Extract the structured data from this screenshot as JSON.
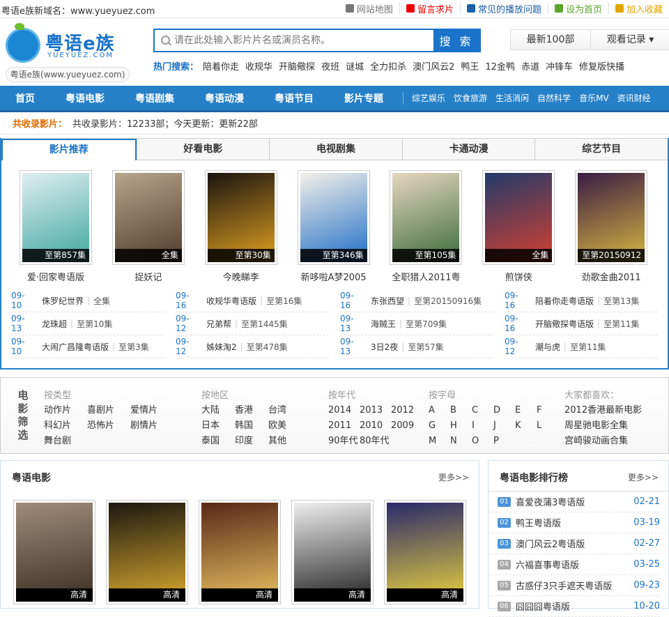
{
  "topbar": {
    "domain_text": "粤语e族新域名：www.yueyuez.com",
    "links": [
      {
        "label": "网站地图",
        "icon": "map-icon",
        "color": "#777"
      },
      {
        "label": "留言求片",
        "icon": "message-icon",
        "color": "#e00"
      },
      {
        "label": "常见的播放问题",
        "icon": "help-icon",
        "color": "#1b5fa8"
      },
      {
        "label": "设为首页",
        "icon": "plus-icon",
        "color": "#5aa52a"
      },
      {
        "label": "加入收藏",
        "icon": "star-icon",
        "color": "#e5a500"
      }
    ]
  },
  "logo": {
    "name": "粤语e族",
    "en": "YUEYUEZ.COM",
    "sub": "粤语e族(www.yueyuez.com)"
  },
  "search": {
    "placeholder": "请在此处输入影片片名或演员名称。",
    "button": "搜 索"
  },
  "hot": {
    "label": "热门搜索：",
    "keywords": [
      "陪着你走",
      "收规华",
      "开脑儆探",
      "夜班",
      "谜城",
      "全力扣杀",
      "澳门风云2",
      "鸭王",
      "12金鸭",
      "赤道",
      "冲锋车",
      "修复版快播"
    ]
  },
  "header_buttons": [
    "最新100部",
    "观看记录 ▾"
  ],
  "nav": {
    "main": [
      "首页",
      "粤语电影",
      "粤语剧集",
      "粤语动漫",
      "粤语节目",
      "影片专题"
    ],
    "sub": [
      "综艺娱乐",
      "饮食旅游",
      "生活消闲",
      "自然科学",
      "音乐MV",
      "资讯财经"
    ]
  },
  "stats": {
    "label": "共收录影片：",
    "text": "共收录影片：12233部；今天更新：更新22部"
  },
  "tabs": [
    "影片推荐",
    "好看电影",
    "电视剧集",
    "卡通动漫",
    "综艺节目"
  ],
  "recommend": [
    {
      "title": "爱·回家粤语版",
      "caption": "至第857集",
      "bg": "#dfeef0",
      "fg": "#3fa7a0"
    },
    {
      "title": "捉妖记",
      "caption": "全集",
      "bg": "#b8a58c",
      "fg": "#4f3b2a"
    },
    {
      "title": "今晚睇李",
      "caption": "至第30集",
      "bg": "#1a1410",
      "fg": "#e0a020"
    },
    {
      "title": "新哆啦A梦2005",
      "caption": "至第346集",
      "bg": "#f3f0e8",
      "fg": "#1f6ec8"
    },
    {
      "title": "全职猎人2011粤",
      "caption": "至第105集",
      "bg": "#e6d7c0",
      "fg": "#3b6b3b"
    },
    {
      "title": "煎饼侠",
      "caption": "全集",
      "bg": "#223a6a",
      "fg": "#d54030"
    },
    {
      "title": "劲歌金曲2011",
      "caption": "至第20150912集",
      "bg": "#3a1c44",
      "fg": "#d7b640"
    }
  ],
  "updates": [
    {
      "date": "09-10",
      "title": "侏罗纪世界",
      "ep": "全集"
    },
    {
      "date": "09-16",
      "title": "收规华粤语版",
      "ep": "至第16集"
    },
    {
      "date": "09-16",
      "title": "东张西望",
      "ep": "至第20150916集"
    },
    {
      "date": "09-16",
      "title": "陪着你走粤语版",
      "ep": "至第13集"
    },
    {
      "date": "09-13",
      "title": "龙珠超",
      "ep": "至第10集"
    },
    {
      "date": "09-12",
      "title": "兄弟帮",
      "ep": "至第1445集"
    },
    {
      "date": "09-13",
      "title": "海贼王",
      "ep": "至第709集"
    },
    {
      "date": "09-16",
      "title": "开脑儆探粤语版",
      "ep": "至第11集"
    },
    {
      "date": "09-10",
      "title": "大闹广昌隆粤语版",
      "ep": "至第3集"
    },
    {
      "date": "09-12",
      "title": "姊妹淘2",
      "ep": "至第478集"
    },
    {
      "date": "09-13",
      "title": "3日2夜",
      "ep": "至第57集"
    },
    {
      "date": "09-12",
      "title": "潮与虎",
      "ep": "至第11集"
    }
  ],
  "filter": {
    "title": "电影筛选",
    "type": {
      "heading": "按类型",
      "items": [
        "动作片",
        "喜剧片",
        "爱情片",
        "科幻片",
        "恐怖片",
        "剧情片",
        "舞台剧"
      ]
    },
    "region": {
      "heading": "按地区",
      "items": [
        "大陆",
        "香港",
        "台湾",
        "日本",
        "韩国",
        "欧美",
        "泰国",
        "印度",
        "其他"
      ]
    },
    "year": {
      "heading": "按年代",
      "items": [
        "2014",
        "2013",
        "2012",
        "2011",
        "2010",
        "2009",
        "90年代",
        "80年代"
      ]
    },
    "letter": {
      "heading": "按字母",
      "items": [
        "A",
        "B",
        "C",
        "D",
        "E",
        "F",
        "G",
        "H",
        "I",
        "J",
        "K",
        "L",
        "M",
        "N",
        "O",
        "P"
      ]
    },
    "like": {
      "heading": "大家都喜欢：",
      "items": [
        "2012香港最新电影",
        "周星驰电影全集",
        "宫崎骏动画合集"
      ]
    }
  },
  "movies": {
    "title": "粤语电影",
    "more": "更多>>",
    "items": [
      {
        "caption": "高清",
        "bg": "#9d8c78",
        "fg": "#3c2e22"
      },
      {
        "caption": "高清",
        "bg": "#1c1810",
        "fg": "#d8a830"
      },
      {
        "caption": "高清",
        "bg": "#5a2818",
        "fg": "#e8c060"
      },
      {
        "caption": "高清",
        "bg": "#eeeeee",
        "fg": "#222222"
      },
      {
        "caption": "高清",
        "bg": "#2a2a6a",
        "fg": "#e8d040"
      }
    ]
  },
  "rank": {
    "title": "粤语电影排行榜",
    "more": "更多>>",
    "items": [
      {
        "num": "01",
        "title": "喜爱夜蒲3粤语版",
        "date": "02-21"
      },
      {
        "num": "02",
        "title": "鸭王粤语版",
        "date": "03-19"
      },
      {
        "num": "03",
        "title": "澳门风云2粤语版",
        "date": "02-27"
      },
      {
        "num": "04",
        "title": "六福喜事粤语版",
        "date": "03-25"
      },
      {
        "num": "05",
        "title": "古惑仔3只手遮天粤语版",
        "date": "09-23"
      },
      {
        "num": "06",
        "title": "囧囧囧粤语版",
        "date": "10-20"
      }
    ]
  },
  "colors": {
    "accent": "#2680c8",
    "link": "#1a73c9",
    "orange": "#e36a00"
  }
}
